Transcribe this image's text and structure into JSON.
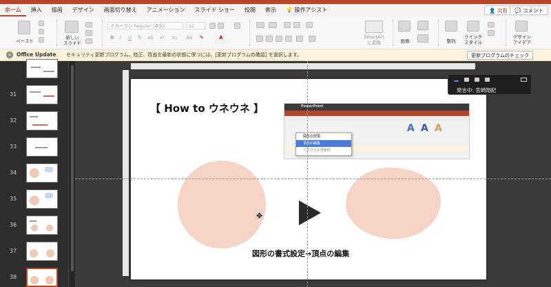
{
  "ribbon": {
    "tabs": [
      "ホーム",
      "挿入",
      "描画",
      "デザイン",
      "画面切り替え",
      "アニメーション",
      "スライド ショー",
      "校閲",
      "表示",
      "操作アシスト"
    ],
    "active_tab": "ホーム",
    "share_label": "共有",
    "comment_label": "コメント"
  },
  "toolbar": {
    "paste_label": "ペースト",
    "new_slide_label": "新しい\nスライド",
    "font_name": "ホカーマン Regular (本文)",
    "font_size": "12",
    "smartart_label": "SmartArt\nに変換",
    "image_label": "画像",
    "arrange_label": "整列",
    "quick_styles_label": "クイック\nスタイル",
    "design_ideas_label": "デザイン\nアイデア"
  },
  "notice": {
    "title": "Office Update",
    "message": "セキュリティ更新プログラム、修正、改善を最新の状態に保つには、[更新プログラムの確認] を選択します。",
    "button": "更新プログラムのチェック"
  },
  "sidebar": {
    "slides": [
      {
        "num": "31"
      },
      {
        "num": "32"
      },
      {
        "num": "33"
      },
      {
        "num": "34"
      },
      {
        "num": "35"
      },
      {
        "num": "36"
      },
      {
        "num": "37"
      },
      {
        "num": "38"
      }
    ]
  },
  "slide": {
    "title": "【 How to ウネウネ 】",
    "caption": "図形の書式設定→頂点の編集",
    "embedded": {
      "app_name": "PowerPoint",
      "menu_item_1": "図形の変更",
      "menu_item_2": "頂点の編集",
      "menu_item_3": "コネクタの再接続"
    }
  },
  "overlay": {
    "status": "発言中: 宮崎翔紀"
  },
  "colors": {
    "accent": "#b7472a",
    "shape_fill": "#f6d5c7"
  }
}
